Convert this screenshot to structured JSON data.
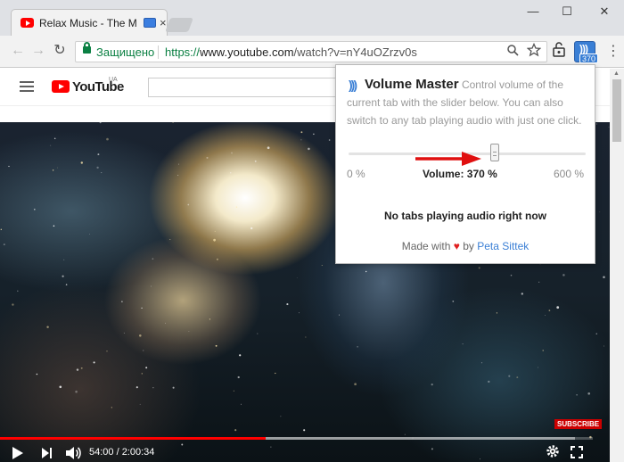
{
  "browser": {
    "tab_title": "Relax Music - The Mo",
    "close_glyph": "×",
    "window_controls": {
      "minimize": "—",
      "maximize": "☐",
      "close": "✕"
    },
    "nav": {
      "back": "←",
      "forward": "→",
      "reload": "↻"
    },
    "security_label": "Защищено",
    "url_scheme": "https://",
    "url_host": "www.youtube.com",
    "url_path": "/watch?v=nY4uOZrzv0s",
    "extension_badge": "370",
    "menu_glyph": "⋮"
  },
  "youtube": {
    "logo_text": "YouTube",
    "region": "UA",
    "subscribe_label": "SUBSCRIBE",
    "time_display": "54:00 / 2:00:34",
    "progress_played": 0.448,
    "progress_buffered": 0.97
  },
  "popup": {
    "title": "Volume Master",
    "description": "Control volume of the current tab with the slider below. You can also switch to any tab playing audio with just one click.",
    "min_label": "0 %",
    "max_label": "600 %",
    "volume_label": "Volume: 370 %",
    "volume_value": 370,
    "volume_max": 600,
    "no_tabs_message": "No tabs playing audio right now",
    "made_with_prefix": "Made with",
    "heart": "♥",
    "made_with_by": "by",
    "author": "Peta Sittek"
  },
  "colors": {
    "accent": "#3a7fd5",
    "progress": "#ff0000",
    "secure": "#0b8043",
    "arrow": "#e01010"
  },
  "icons": [
    "youtube-favicon",
    "cast-icon",
    "lock-icon",
    "zoom-icon",
    "star-icon",
    "volume-master-icon",
    "gear-icon",
    "fullscreen-icon",
    "play-icon",
    "next-icon",
    "volume-icon"
  ]
}
